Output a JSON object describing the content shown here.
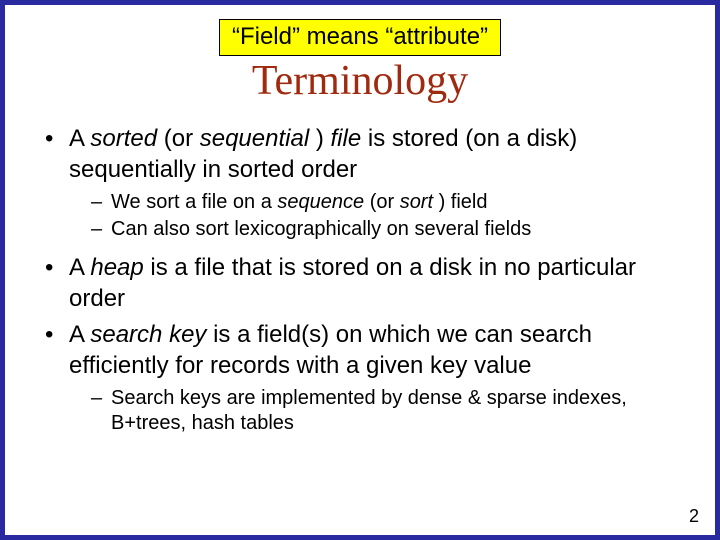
{
  "callout": "“Field” means “attribute”",
  "title": "Terminology",
  "b1": {
    "p1": "A ",
    "i1": "sorted",
    "p2": " (or ",
    "i2": "sequential ",
    "p3": ") ",
    "i3": "file",
    "p4": " is stored (on a disk) sequentially in sorted order",
    "s1": {
      "p1": "We sort a file on a ",
      "i1": "sequence ",
      "p2": "(or ",
      "i2": "sort ",
      "p3": ") field"
    },
    "s2": "Can also sort lexicographically on several fields"
  },
  "b2": {
    "p1": "A ",
    "i1": "heap",
    "p2": " is a file that is stored on a disk in no particular order"
  },
  "b3": {
    "p1": "A ",
    "i1": "search key",
    "p2": " is a field(s) on which we can search efficiently for records with a given key value",
    "s1": "Search keys are implemented by dense & sparse indexes, B+trees, hash tables"
  },
  "page_number": "2"
}
